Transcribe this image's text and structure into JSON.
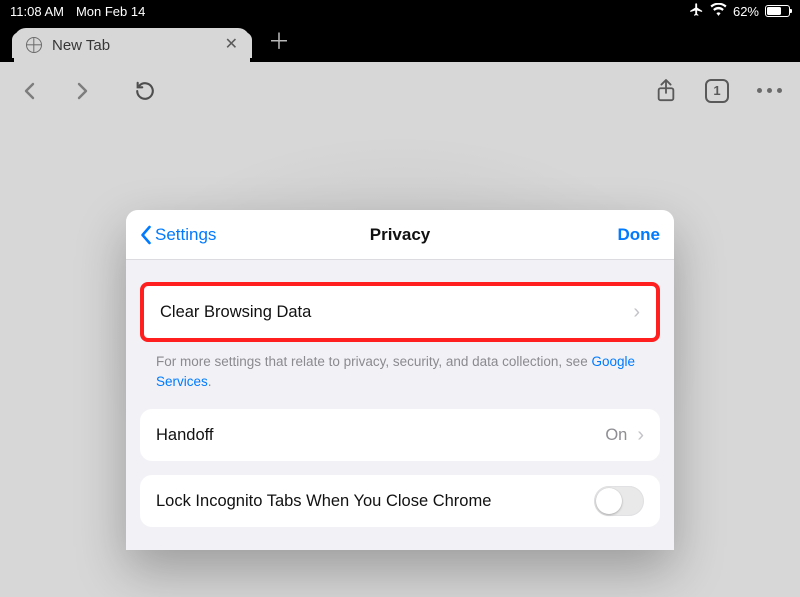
{
  "status": {
    "time": "11:08 AM",
    "date": "Mon Feb 14",
    "battery_pct": "62%"
  },
  "tabs": {
    "active_title": "New Tab",
    "count": "1"
  },
  "sheet": {
    "back_label": "Settings",
    "title": "Privacy",
    "done_label": "Done",
    "clear_label": "Clear Browsing Data",
    "footer_prefix": "For more settings that relate to privacy, security, and data collection, see ",
    "footer_link": "Google Services",
    "footer_suffix": ".",
    "handoff_label": "Handoff",
    "handoff_value": "On",
    "lock_label": "Lock Incognito Tabs When You Close Chrome",
    "lock_on": false,
    "highlight": "clear_browsing_data"
  }
}
